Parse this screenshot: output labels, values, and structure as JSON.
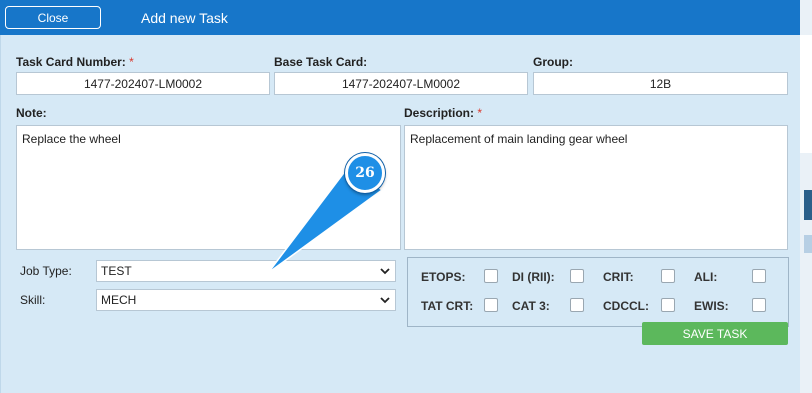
{
  "header": {
    "close_label": "Close",
    "title": "Add new Task"
  },
  "form": {
    "task_card_number": {
      "label": "Task Card Number:",
      "required": "*",
      "value": "1477-202407-LM0002"
    },
    "base_task_card": {
      "label": "Base Task Card:",
      "value": "1477-202407-LM0002"
    },
    "group": {
      "label": "Group:",
      "value": "12B"
    },
    "note": {
      "label": "Note:",
      "value": "Replace the wheel"
    },
    "description": {
      "label": "Description:",
      "required": "*",
      "value": "Replacement of main landing gear wheel"
    },
    "job_type": {
      "label": "Job Type:",
      "value": "TEST"
    },
    "skill": {
      "label": "Skill:",
      "value": "MECH"
    }
  },
  "flags": {
    "etops": "ETOPS:",
    "di_rii": "DI (RII):",
    "crit": "CRIT:",
    "ali": "ALI:",
    "tat_crt": "TAT CRT:",
    "cat3": "CAT 3:",
    "cdccl": "CDCCL:",
    "ewis": "EWIS:"
  },
  "actions": {
    "save_label": "SAVE TASK"
  },
  "annotation": {
    "step_number": "26"
  },
  "colors": {
    "header": "#1776c9",
    "panel": "#d6e9f6",
    "save": "#5cb85c",
    "badge": "#1e8fe6",
    "required": "#d9362b"
  }
}
